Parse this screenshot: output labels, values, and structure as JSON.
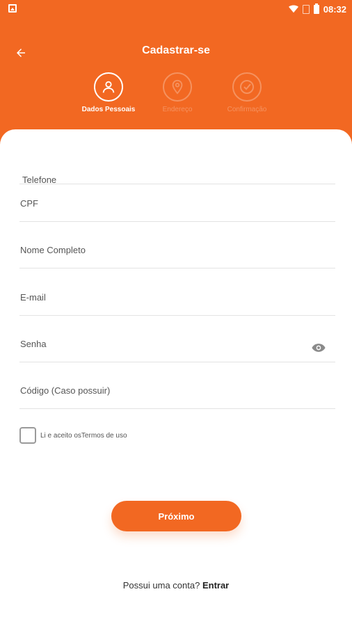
{
  "status_bar": {
    "time": "08:32"
  },
  "header": {
    "title": "Cadastrar-se",
    "steps": [
      {
        "label": "Dados Pessoais",
        "icon": "person-icon",
        "active": true
      },
      {
        "label": "Endereço",
        "icon": "location-pin-icon",
        "active": false
      },
      {
        "label": "Confirmação",
        "icon": "check-circle-icon",
        "active": false
      }
    ]
  },
  "form": {
    "fields": [
      {
        "label": "Telefone"
      },
      {
        "label": "CPF"
      },
      {
        "label": "Nome Completo"
      },
      {
        "label": "E-mail"
      },
      {
        "label": "Senha",
        "icon": "eye-icon"
      },
      {
        "label": "Código (Caso possuir)"
      }
    ],
    "terms_label": "Li e aceito osTermos de uso"
  },
  "actions": {
    "next_label": "Próximo"
  },
  "footer": {
    "question": "Possui uma conta?",
    "link": "Entrar"
  },
  "colors": {
    "accent": "#f26822",
    "card": "#ffffff"
  }
}
